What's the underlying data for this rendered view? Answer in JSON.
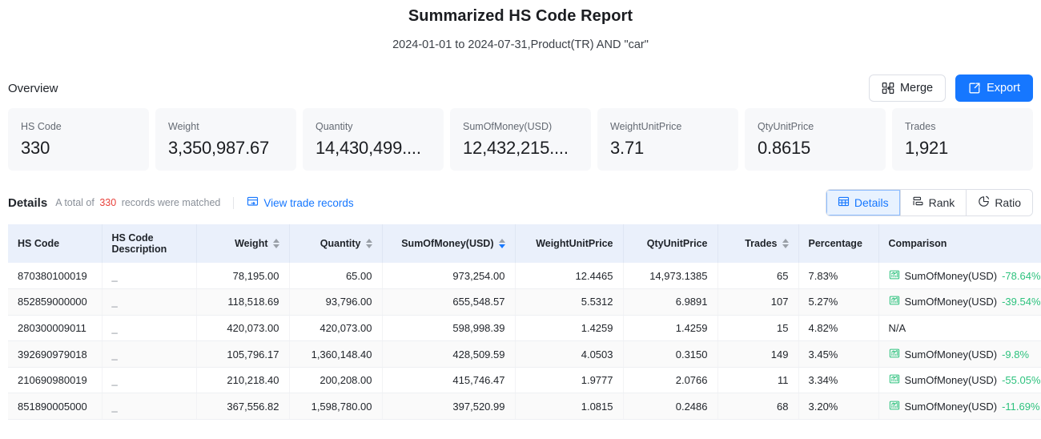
{
  "report": {
    "title": "Summarized HS Code Report",
    "subtitle": "2024-01-01 to 2024-07-31,Product(TR) AND \"car\""
  },
  "overview": {
    "section_label": "Overview",
    "merge_label": "Merge",
    "export_label": "Export",
    "cards": [
      {
        "label": "HS Code",
        "value": "330"
      },
      {
        "label": "Weight",
        "value": "3,350,987.67"
      },
      {
        "label": "Quantity",
        "value": "14,430,499...."
      },
      {
        "label": "SumOfMoney(USD)",
        "value": "12,432,215...."
      },
      {
        "label": "WeightUnitPrice",
        "value": "3.71"
      },
      {
        "label": "QtyUnitPrice",
        "value": "0.8615"
      },
      {
        "label": "Trades",
        "value": "1,921"
      }
    ]
  },
  "details": {
    "title": "Details",
    "meta_prefix": "A total of",
    "count": "330",
    "meta_suffix": "records were matched",
    "view_trade_records": "View trade records",
    "view_modes": [
      {
        "label": "Details",
        "icon": "table-icon",
        "active": true
      },
      {
        "label": "Rank",
        "icon": "rank-icon",
        "active": false
      },
      {
        "label": "Ratio",
        "icon": "pie-icon",
        "active": false
      }
    ]
  },
  "table": {
    "columns": [
      {
        "key": "hs_code",
        "label": "HS Code",
        "align": "left",
        "sortable": false,
        "sort": null
      },
      {
        "key": "description",
        "label": "HS Code Description",
        "align": "left",
        "sortable": false,
        "sort": null
      },
      {
        "key": "weight",
        "label": "Weight",
        "align": "right",
        "sortable": true,
        "sort": null
      },
      {
        "key": "quantity",
        "label": "Quantity",
        "align": "right",
        "sortable": true,
        "sort": null
      },
      {
        "key": "sum_of_money",
        "label": "SumOfMoney(USD)",
        "align": "right",
        "sortable": true,
        "sort": "desc"
      },
      {
        "key": "weight_unit",
        "label": "WeightUnitPrice",
        "align": "right",
        "sortable": false,
        "sort": null
      },
      {
        "key": "qty_unit",
        "label": "QtyUnitPrice",
        "align": "right",
        "sortable": false,
        "sort": null
      },
      {
        "key": "trades",
        "label": "Trades",
        "align": "right",
        "sortable": true,
        "sort": null
      },
      {
        "key": "percentage",
        "label": "Percentage",
        "align": "left",
        "sortable": false,
        "sort": null
      },
      {
        "key": "comparison",
        "label": "Comparison",
        "align": "left",
        "sortable": false,
        "sort": null
      }
    ],
    "rows": [
      {
        "hs_code": "870380100019",
        "description": "_",
        "weight": "78,195.00",
        "quantity": "65.00",
        "sum_of_money": "973,254.00",
        "weight_unit": "12.4465",
        "qty_unit": "14,973.1385",
        "trades": "65",
        "percentage": "7.83%",
        "comparison": {
          "metric": "SumOfMoney(USD)",
          "delta": "-78.64%",
          "has_icon": true
        }
      },
      {
        "hs_code": "852859000000",
        "description": "_",
        "weight": "118,518.69",
        "quantity": "93,796.00",
        "sum_of_money": "655,548.57",
        "weight_unit": "5.5312",
        "qty_unit": "6.9891",
        "trades": "107",
        "percentage": "5.27%",
        "comparison": {
          "metric": "SumOfMoney(USD)",
          "delta": "-39.54%",
          "has_icon": true
        }
      },
      {
        "hs_code": "280300009011",
        "description": "_",
        "weight": "420,073.00",
        "quantity": "420,073.00",
        "sum_of_money": "598,998.39",
        "weight_unit": "1.4259",
        "qty_unit": "1.4259",
        "trades": "15",
        "percentage": "4.82%",
        "comparison": {
          "metric": "N/A",
          "delta": "",
          "has_icon": false
        }
      },
      {
        "hs_code": "392690979018",
        "description": "_",
        "weight": "105,796.17",
        "quantity": "1,360,148.40",
        "sum_of_money": "428,509.59",
        "weight_unit": "4.0503",
        "qty_unit": "0.3150",
        "trades": "149",
        "percentage": "3.45%",
        "comparison": {
          "metric": "SumOfMoney(USD)",
          "delta": "-9.8%",
          "has_icon": true
        }
      },
      {
        "hs_code": "210690980019",
        "description": "_",
        "weight": "210,218.40",
        "quantity": "200,208.00",
        "sum_of_money": "415,746.47",
        "weight_unit": "1.9777",
        "qty_unit": "2.0766",
        "trades": "11",
        "percentage": "3.34%",
        "comparison": {
          "metric": "SumOfMoney(USD)",
          "delta": "-55.05%",
          "has_icon": true
        }
      },
      {
        "hs_code": "851890005000",
        "description": "_",
        "weight": "367,556.82",
        "quantity": "1,598,780.00",
        "sum_of_money": "397,520.99",
        "weight_unit": "1.0815",
        "qty_unit": "0.2486",
        "trades": "68",
        "percentage": "3.20%",
        "comparison": {
          "metric": "SumOfMoney(USD)",
          "delta": "-11.69%",
          "has_icon": true
        }
      }
    ]
  },
  "colors": {
    "accent": "#1677ff",
    "header_bg": "#eaf0fb",
    "card_bg": "#f7f8fa",
    "positive_green": "#2ec27e",
    "count_red": "#e8413b"
  }
}
